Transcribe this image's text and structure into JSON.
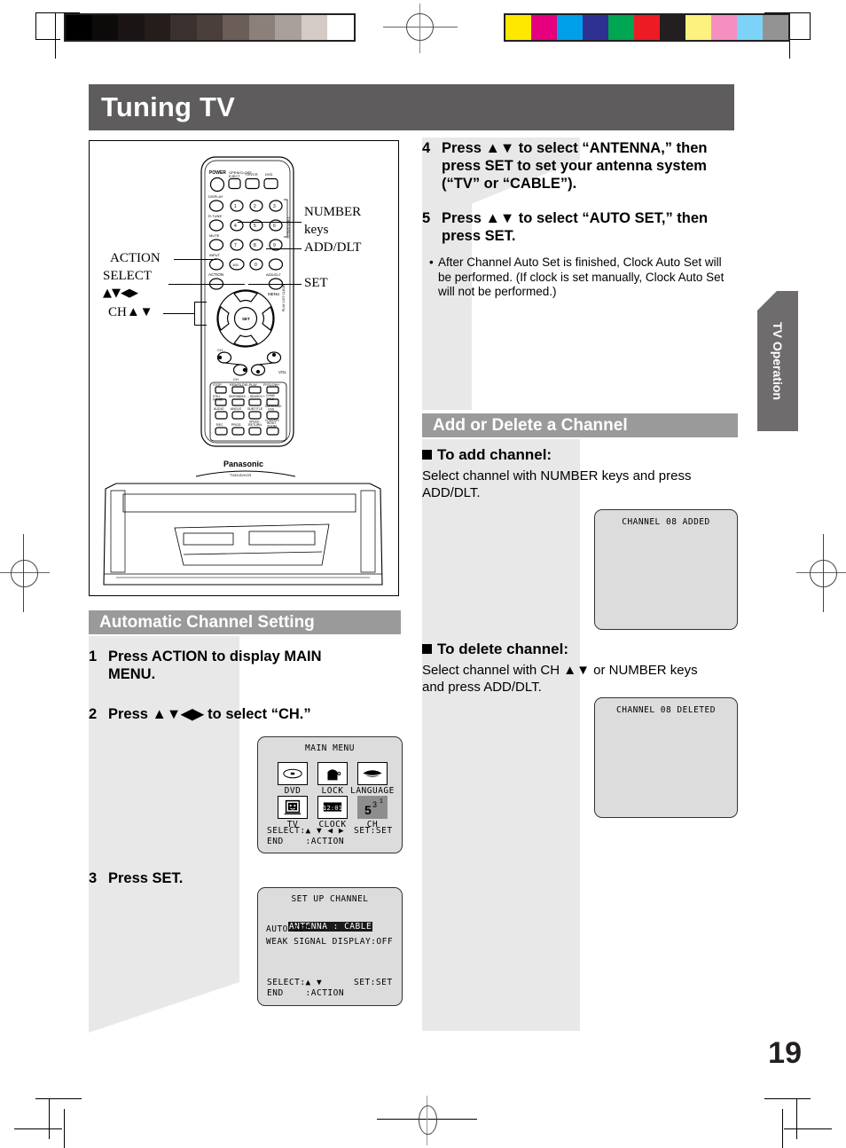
{
  "page": {
    "title": "Tuning TV",
    "number": "19",
    "side_tab": "TV Operation"
  },
  "calibration": {
    "gray_wedge": [
      "#000000",
      "#0d0a0a",
      "#1a1514",
      "#241d1b",
      "#3b312e",
      "#4b3f3b",
      "#6b5d58",
      "#8b807a",
      "#a9a09b",
      "#d4cac6",
      "#ffffff"
    ],
    "color_bar": [
      "#ffe800",
      "#e5007e",
      "#00a0e9",
      "#2e3192",
      "#00a651",
      "#ed1c24",
      "#231f20",
      "#fdf17f",
      "#f48fc0",
      "#7dd3f7",
      "#939393"
    ]
  },
  "figure": {
    "labels": {
      "number_keys_line1": "NUMBER",
      "number_keys_line2": "keys",
      "add_dlt": "ADD/DLT",
      "set": "SET",
      "action": "ACTION",
      "select_line1": "SELECT",
      "select_line2": "▲▼◀▶",
      "ch": "CH▲▼"
    },
    "remote": {
      "brand": "Panasonic",
      "model": "TV/DVD/VCR",
      "top_row": [
        "POWER",
        "OPEN/CLOSE",
        "EJECT",
        "TV/VCR",
        "DVD"
      ],
      "left_column": [
        "DISPLAY",
        "R-TUNE",
        "MUTE",
        "INPUT",
        "ACTION"
      ],
      "right_column": [
        "ADD/DLT",
        "MENU"
      ],
      "side_vertical_1": "TV  DVD  VCR  1",
      "side_vertical_2": "PLAY LIST  CLEAR",
      "number_keys": [
        "1",
        "2",
        "3",
        "4",
        "5",
        "6",
        "7",
        "8",
        "9",
        "100",
        "0"
      ],
      "center_label": "SET",
      "vol_label": "VOL",
      "ch_label": "CH",
      "deck_row1": [
        "STOP",
        "REW/SLOW-",
        "PLAY",
        "FF/SLOW+"
      ],
      "deck_row2": [
        "STILL/PAUSE",
        "SKIP/INDEX -",
        "-SEARCH-",
        "SKIP/INDEX +",
        "CH/AV  TITLE"
      ],
      "deck_row3": [
        "AUDIO",
        "ANGLE",
        "SUBTITLE",
        "SURROUND VSS"
      ],
      "deck_row4": [
        "REC",
        "PROG",
        "SPEED RETURN",
        "COUNTER RESET  ZOOM"
      ]
    }
  },
  "steps_right": [
    {
      "num": "4",
      "text": "Press ▲▼ to select “ANTENNA,” then press SET to set your antenna system (“TV” or “CABLE”)."
    },
    {
      "num": "5",
      "text": "Press ▲▼ to select “AUTO SET,” then press SET."
    }
  ],
  "note_right": {
    "dot": "•",
    "text": "After Channel Auto Set is finished, Clock Auto Set will be performed. (If clock is set manually, Clock Auto Set will not be performed.)"
  },
  "section_auto": {
    "header": "Automatic Channel Setting",
    "steps": [
      {
        "num": "1",
        "text": "Press ACTION to display MAIN MENU."
      },
      {
        "num": "2",
        "text": "Press ▲▼◀▶ to select “CH.”"
      },
      {
        "num": "3",
        "text": "Press SET."
      }
    ]
  },
  "section_add_delete": {
    "header": "Add or Delete a Channel",
    "add": {
      "heading": "To add channel:",
      "text": "Select channel with NUMBER keys and press ADD/DLT."
    },
    "delete": {
      "heading": "To delete channel:",
      "text": "Select channel with CH ▲▼ or NUMBER keys and press ADD/DLT."
    }
  },
  "osd": {
    "main_menu": {
      "title": "MAIN MENU",
      "items": [
        {
          "label": "DVD",
          "selected": false
        },
        {
          "label": "LOCK",
          "selected": false
        },
        {
          "label": "LANGUAGE",
          "selected": false
        },
        {
          "label": "TV",
          "selected": false
        },
        {
          "label": "CLOCK",
          "selected": false
        },
        {
          "label": "CH",
          "selected": true
        }
      ],
      "footer_select": "SELECT:▲ ▼ ◀ ▶",
      "footer_set": "SET:SET",
      "footer_end": "END    :ACTION"
    },
    "set_up_channel": {
      "title": "SET UP CHANNEL",
      "line1": "ANTENNA : CABLE",
      "line2": "AUTO SET",
      "line3": "WEAK SIGNAL DISPLAY:OFF",
      "footer_select": "SELECT:▲ ▼",
      "footer_set": "SET:SET",
      "footer_end": "END    :ACTION"
    },
    "channel_added": "CHANNEL 08 ADDED",
    "channel_deleted": "CHANNEL 08 DELETED"
  }
}
